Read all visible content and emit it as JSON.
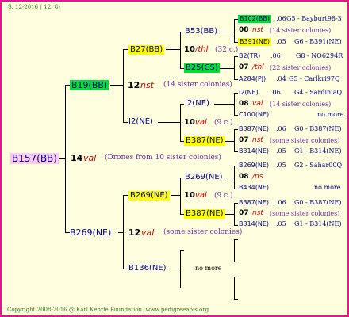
{
  "header_date": "S. 12-2016 ( 12: 8)",
  "footer": "Copyright 2008-2016 @ Karl Kehrle Foundation.   www.pedigreeapis.org",
  "root": {
    "name": "B157(BB)",
    "num": "14",
    "sym": "val",
    "note": "(Drones from 10 sister colonies)"
  },
  "gen1": [
    {
      "name": "B19(BB)",
      "num": "12",
      "sym": "nst",
      "note": "(14 sister colonies)"
    },
    {
      "name": "B269(NE)",
      "num": "12",
      "sym": "val",
      "note": "(some sister colonies)"
    }
  ],
  "gen2": [
    {
      "name": "B27(BB)",
      "num": "10",
      "sym": "/thl",
      "note": "(32 c.)"
    },
    {
      "name": "I2(NE)",
      "num": "10",
      "sym": "val",
      "note": "(9 c.)"
    },
    {
      "name": "B269(NE)",
      "num": "10",
      "sym": "val",
      "note": "(9 c.)"
    },
    {
      "name": "B136(NE)",
      "num": "",
      "sym": "",
      "note": "no more"
    }
  ],
  "gen3": [
    {
      "name": "B53(BB)"
    },
    {
      "name": "B25(CS)"
    },
    {
      "name": "I2(NE)"
    },
    {
      "name": "B387(NE)"
    },
    {
      "name": "B269(NE)"
    },
    {
      "name": "B387(NE)"
    }
  ],
  "gen4": [
    {
      "name": "B102(BB)",
      "year": ".06",
      "id": "G5 - Bayburt98-3"
    },
    {
      "num": "08",
      "sym": "nst",
      "note": "(14 sister colonies)"
    },
    {
      "name": "B391(NE)",
      "year": ".05",
      "id": "G6 - B391(NE)"
    },
    {
      "name": "B2(TR)",
      "year": ".06",
      "id": "G8 - NO6294R"
    },
    {
      "num": "07",
      "sym": "/thl",
      "note": "(22 sister colonies)"
    },
    {
      "name": "A284(PJ)",
      "year": ".04",
      "id": "G5 - Carlkri97Q"
    },
    {
      "name": "I2(NE)",
      "year": ".06",
      "id": "G4 - SardiniaQ"
    },
    {
      "num": "08",
      "sym": "val",
      "note": "(14 sister colonies)"
    },
    {
      "name": "C100(NE)",
      "year": "",
      "id": "no more"
    },
    {
      "name": "B387(NE)",
      "year": ".06",
      "id": "G0 - B387(NE)"
    },
    {
      "num": "07",
      "sym": "nst",
      "note": "(some sister colonies)"
    },
    {
      "name": "B314(NE)",
      "year": ".05",
      "id": "G1 - B314(NE)"
    },
    {
      "name": "B269(NE)",
      "year": ".05",
      "id": "G2 - Sahar00Q"
    },
    {
      "num": "08",
      "sym": "/ns",
      "note": ""
    },
    {
      "name": "B434(NE)",
      "year": "",
      "id": "no more"
    },
    {
      "name": "B387(NE)",
      "year": ".06",
      "id": "G0 - B387(NE)"
    },
    {
      "num": "07",
      "sym": "nst",
      "note": "(some sister colonies)"
    },
    {
      "name": "B314(NE)",
      "year": ".05",
      "id": "G1 - B314(NE)"
    }
  ],
  "colors": {
    "border": "#e0168a",
    "background": "#ffffe0",
    "yellow": "#ffff00",
    "green": "#00dd33",
    "pink": "#ffccee",
    "name": "#000080",
    "symbol": "#cc0000",
    "note": "#6a2a9a"
  }
}
